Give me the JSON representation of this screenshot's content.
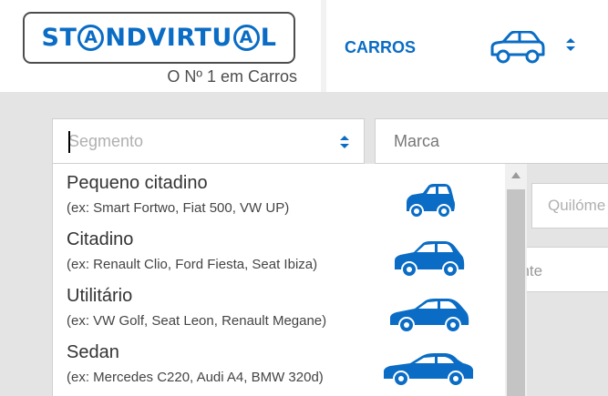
{
  "header": {
    "logo": {
      "text": "STANDVIRTUAL",
      "tagline": "O Nº 1 em Carros"
    },
    "nav": {
      "carros_label": "CARROS",
      "car_icon": "car-icon",
      "sort_icon": "sort-arrows-icon"
    }
  },
  "search": {
    "segmento": {
      "value": "",
      "placeholder": "Segmento"
    },
    "marca": {
      "value": "Marca"
    },
    "quilometros": {
      "placeholder": "Quilóme"
    },
    "combustivel": {
      "text": "ante"
    }
  },
  "segment_dropdown": {
    "items": [
      {
        "title": "Pequeno citadino",
        "example": "(ex: Smart Fortwo, Fiat 500, VW UP)",
        "icon": "small-city-car-icon"
      },
      {
        "title": "Citadino",
        "example": "(ex: Renault Clio, Ford Fiesta, Seat Ibiza)",
        "icon": "city-car-icon"
      },
      {
        "title": "Utilitário",
        "example": "(ex: VW Golf, Seat Leon, Renault Megane)",
        "icon": "hatchback-icon"
      },
      {
        "title": "Sedan",
        "example": "(ex: Mercedes C220, Audi A4, BMW 320d)",
        "icon": "sedan-icon"
      }
    ]
  },
  "colors": {
    "brand": "#0a6cc4",
    "logo_border": "#4d4d4d",
    "background": "#e4e4e4"
  }
}
